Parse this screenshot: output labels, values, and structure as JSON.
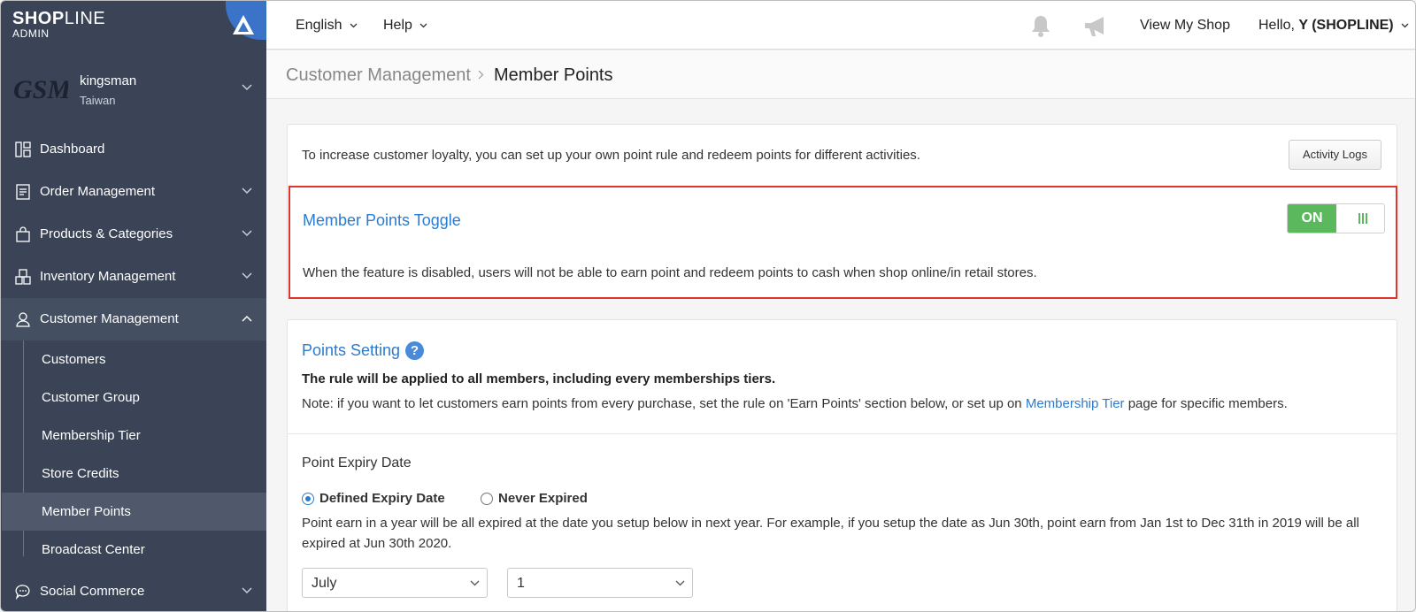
{
  "brand": {
    "logo_bold": "SHOP",
    "logo_thin": "LINE",
    "logo_sub": "ADMIN"
  },
  "store": {
    "logo_text": "GSM",
    "name": "kingsman",
    "region": "Taiwan"
  },
  "sidebar": {
    "items": [
      {
        "label": "Dashboard",
        "icon": "dashboard-icon"
      },
      {
        "label": "Order Management",
        "icon": "order-icon"
      },
      {
        "label": "Products & Categories",
        "icon": "bag-icon"
      },
      {
        "label": "Inventory Management",
        "icon": "boxes-icon"
      },
      {
        "label": "Customer Management",
        "icon": "user-icon"
      },
      {
        "label": "Social Commerce",
        "icon": "chat-icon"
      }
    ],
    "sub_items": [
      {
        "label": "Customers"
      },
      {
        "label": "Customer Group"
      },
      {
        "label": "Membership Tier"
      },
      {
        "label": "Store Credits"
      },
      {
        "label": "Member Points"
      },
      {
        "label": "Broadcast Center"
      }
    ]
  },
  "topbar": {
    "language": "English",
    "help": "Help",
    "view_shop": "View My Shop",
    "greeting_prefix": "Hello, ",
    "user": "Y (SHOPLINE)"
  },
  "breadcrumb": {
    "parent": "Customer Management",
    "current": "Member Points"
  },
  "intro": {
    "text": "To increase customer loyalty, you can set up your own point rule and redeem points for different activities.",
    "activity_logs_label": "Activity Logs"
  },
  "toggle_section": {
    "title": "Member Points Toggle",
    "state_label": "ON",
    "description": "When the feature is disabled, users will not be able to earn point and redeem points to cash when shop online/in retail stores."
  },
  "points_setting": {
    "title": "Points Setting",
    "help_glyph": "?",
    "rule": "The rule will be applied to all members, including every memberships tiers.",
    "note_before": "Note: if you want to let customers earn points from every purchase, set the rule on 'Earn Points' section below, or set up on ",
    "note_link": "Membership Tier",
    "note_after": " page for specific members."
  },
  "expiry": {
    "title": "Point Expiry Date",
    "option_defined": "Defined Expiry Date",
    "option_never": "Never Expired",
    "description": "Point earn in a year will be all expired at the date you setup below in next year. For example, if you setup the date as Jun 30th, point earn from Jan 1st to Dec 31th in 2019 will be all expired at Jun 30th 2020.",
    "month_value": "July",
    "day_value": "1"
  },
  "colors": {
    "sidebar_bg": "#3a4456",
    "accent_blue": "#2b7bd0",
    "toggle_on": "#5cb85c",
    "highlight_red": "#e0342d"
  }
}
